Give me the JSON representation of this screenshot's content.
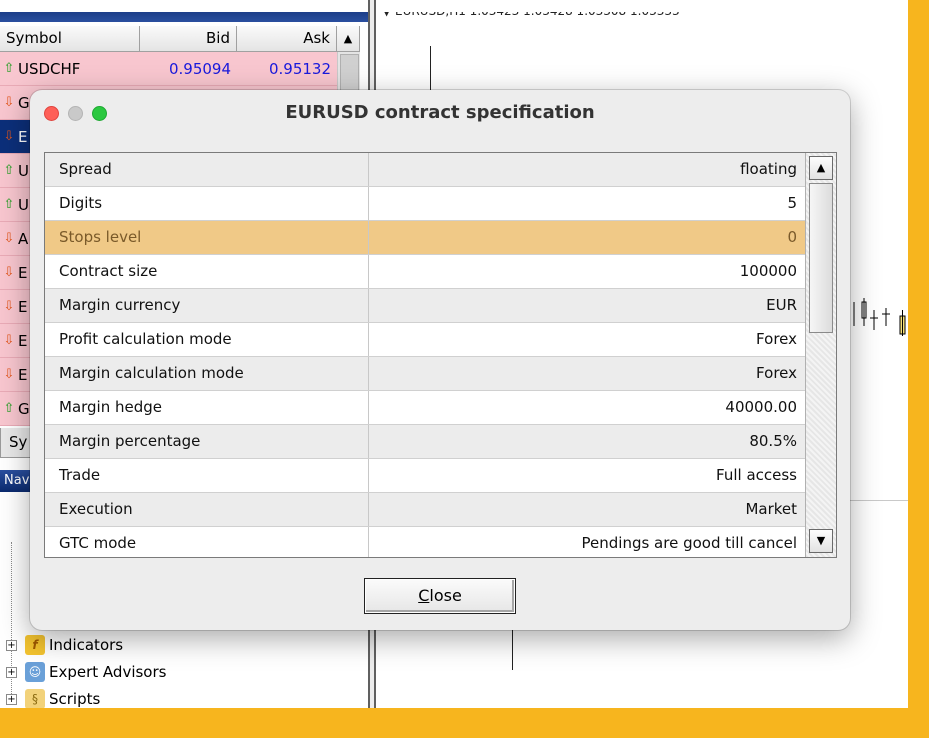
{
  "market_watch": {
    "columns": {
      "symbol": "Symbol",
      "bid": "Bid",
      "ask": "Ask"
    },
    "rows": [
      {
        "symbol": "USDCHF",
        "bid": "0.95094",
        "ask": "0.95132",
        "dir": "up"
      },
      {
        "symbol": "G",
        "bid": "",
        "ask": "",
        "dir": "down"
      },
      {
        "symbol": "E",
        "bid": "",
        "ask": "",
        "dir": "down"
      },
      {
        "symbol": "U",
        "bid": "",
        "ask": "",
        "dir": "up"
      },
      {
        "symbol": "U",
        "bid": "",
        "ask": "",
        "dir": "up"
      },
      {
        "symbol": "A",
        "bid": "",
        "ask": "",
        "dir": "down"
      },
      {
        "symbol": "E",
        "bid": "",
        "ask": "",
        "dir": "down"
      },
      {
        "symbol": "E",
        "bid": "",
        "ask": "",
        "dir": "down"
      },
      {
        "symbol": "E",
        "bid": "",
        "ask": "",
        "dir": "down"
      },
      {
        "symbol": "E",
        "bid": "",
        "ask": "",
        "dir": "down"
      },
      {
        "symbol": "G",
        "bid": "",
        "ask": "",
        "dir": "up"
      }
    ],
    "tab_label": "Sy"
  },
  "navigator": {
    "title": "Navi",
    "items": [
      {
        "label": "Indicators"
      },
      {
        "label": "Expert Advisors"
      },
      {
        "label": "Scripts"
      }
    ]
  },
  "chart": {
    "info": "EURUSD,H1  1.03423 1.03428 1.03308 1.03333"
  },
  "dialog": {
    "title": "EURUSD contract specification",
    "rows": [
      {
        "key": "Spread",
        "value": "floating"
      },
      {
        "key": "Digits",
        "value": "5"
      },
      {
        "key": "Stops level",
        "value": "0"
      },
      {
        "key": "Contract size",
        "value": "100000"
      },
      {
        "key": "Margin currency",
        "value": "EUR"
      },
      {
        "key": "Profit calculation mode",
        "value": "Forex"
      },
      {
        "key": "Margin calculation mode",
        "value": "Forex"
      },
      {
        "key": "Margin hedge",
        "value": "40000.00"
      },
      {
        "key": "Margin percentage",
        "value": "80.5%"
      },
      {
        "key": "Trade",
        "value": "Full access"
      },
      {
        "key": "Execution",
        "value": "Market"
      },
      {
        "key": "GTC mode",
        "value": "Pendings are good till cancel"
      }
    ],
    "close_label_mnemonic": "C",
    "close_label_rest": "lose"
  },
  "colors": {
    "background_accent": "#f7b51e",
    "highlight_row": "#f0c987",
    "selected_row": "#0c2f7a",
    "quote_row": "#f8c6cf"
  }
}
